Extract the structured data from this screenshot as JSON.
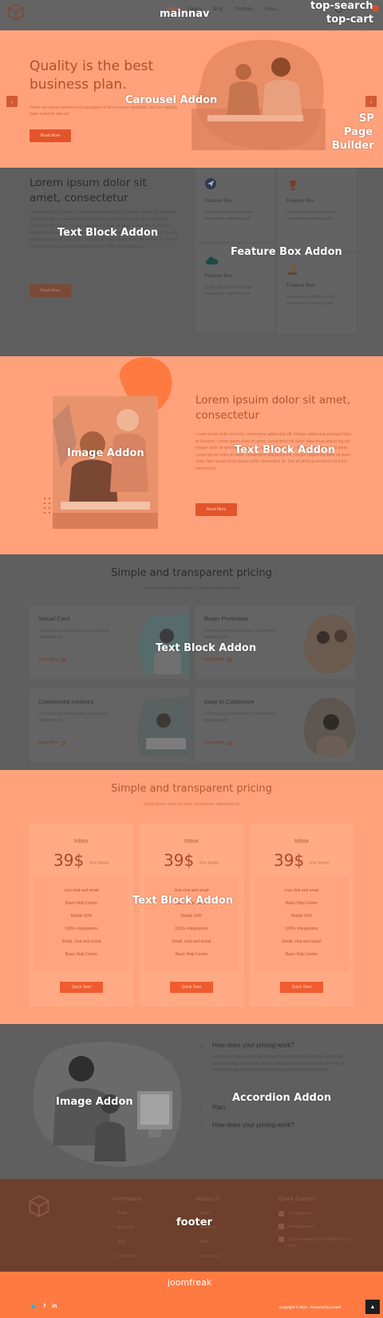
{
  "overlay_labels": {
    "mainnav": "mainnav",
    "top_search": "top-search",
    "top_cart": "top-cart",
    "carousel": "Carousel Addon",
    "sp_page_builder": [
      "SP",
      "Page",
      "Builder"
    ],
    "text_block_1": "Text Block Addon",
    "feature_box": "Feature Box Addon",
    "image_1": "Image Addon",
    "text_block_2": "Text Block Addon",
    "text_block_3": "Text Block Addon",
    "text_block_4": "Text Block Addon",
    "image_2": "Image Addon",
    "accordion": "Accordion Addon",
    "footer": "footer"
  },
  "header": {
    "nav": [
      {
        "label": "Home",
        "active": true
      },
      {
        "label": "Pages",
        "has_dropdown": true
      },
      {
        "label": "Blog",
        "has_dropdown": true
      },
      {
        "label": "Portfolio",
        "has_dropdown": true
      },
      {
        "label": "Shop",
        "has_dropdown": true
      }
    ]
  },
  "carousel": {
    "title": "Quality is the best business plan.",
    "description": "There are many variations of passages of lorem ipsum available, but the majority have suffered altered.",
    "button": "Read More",
    "prev": "‹",
    "next": "›"
  },
  "intro": {
    "title": "Lorem ipsum dolor sit amet, consectetur",
    "body": "Lorem ipsum dolor sit amet, consectetur adipiscing elit. Integer adipiscing and eget dolor at tincidunt. Lorem ipsum dolor sit amet, consectetur elit dolor. Maecenas adipiscing elit. Integer dolor sit amet ipsum dolor sit amet. Donec ipsum ultricies ullamcorper sit amet. Lorem ipsum dolor sit amet, consectetur adipiscing elit. Integer adipiscing dolor sit amet dolor. Nam ipsum lorem ipsum dolor elementum sit. Sed sit amet quam lorem sit dolor elementum. Nec dolor sit amet ipsum.",
    "button": "Read More"
  },
  "feature_boxes": [
    {
      "title": "Feature Box",
      "text": "Lorem ipsum dolor sit amet, consectetur adipiscing elit",
      "icon": "send-icon"
    },
    {
      "title": "Feature Box",
      "text": "Lorem ipsum dolor sit amet, consectetur adipiscing elit",
      "icon": "trophy-icon"
    },
    {
      "title": "Feature Box",
      "text": "Lorem ipsum dolor sit amet, consectetur adipiscing elit",
      "icon": "cloud-icon"
    },
    {
      "title": "Feature Box",
      "text": "Lorem ipsum dolor sit amet, consectetur adipiscing elit",
      "icon": "hand-coin-icon"
    }
  ],
  "about": {
    "title": "Lorem ipsuim dolor sit amet, consectetur",
    "body": "Lorem ipsum dolor sit amet, consectetur adipiscing elit. Integer adipiscing and eget dolor at tincidunt. Lorem ipsum dolor sit amet, consectetur elit dolor. Maecenas adipiscing elit. Integer dolor sit amet ipsum dolor sit amet. Donec ipsum ultricies ullamcorper sit amet. Lorem ipsum dolor sit amet, consectetur adipiscing elit. Integer adipiscing dolor sit amet dolor. Nam ipsum lorem ipsum dolor elementum sit. Sed sit amet quam lorem sit dolor elementum.",
    "button": "Read More"
  },
  "pricing_features": {
    "heading": "Simple and transparent pricing",
    "sub": "Lorem ipsum dolor sit amet, consectetur adipiscing elit",
    "cards": [
      {
        "title": "Virtual Card",
        "text": "Lorem ipsum dolor sit amet, consectetur adipiscing elit",
        "link": "Read More"
      },
      {
        "title": "Buyer Protection",
        "text": "Lorem ipsum dolor sit amet, consectetur adipiscing elit",
        "link": "Read More"
      },
      {
        "title": "Customized Invoices",
        "text": "Lorem ipsum dolor sit amet, consectetur adipiscing elit",
        "link": "Read More"
      },
      {
        "title": "Easy to Customize",
        "text": "Lorem ipsum dolor sit amet, consectetur adipiscing elit",
        "link": "Read More"
      }
    ]
  },
  "pricing_tables": {
    "heading": "Simple and transparent pricing",
    "sub": "Lorem ipsum dolor sit amet, consectetur adipiscing elit",
    "tables": [
      {
        "name": "Inbox",
        "price": "39$",
        "period": "/Per Month",
        "button": "Quick Start"
      },
      {
        "name": "Inbox",
        "price": "39$",
        "period": "/Per Month",
        "button": "Quick Start"
      },
      {
        "name": "Inbox",
        "price": "39$",
        "period": "/Per Month",
        "button": "Quick Start"
      }
    ],
    "features": [
      "Live chat and email",
      "Basic Help Center",
      "Mobile SDK",
      "1000+ integrations",
      "Email, chat and social",
      "Basic Help Center"
    ]
  },
  "accordion": {
    "items": [
      {
        "q": "How does your pricing work?",
        "open": true
      },
      {
        "q": "Plan",
        "open": false
      },
      {
        "q": "How does your pricing work?",
        "open": false
      }
    ],
    "answer": "Lorem ipsum dolor sit amet, consectetur adipiscing elit. Integer adipiscing and eget dolor at tincidunt. Integer adipiscing dolor sit amet ipsum dolor sit amet. Nam ipsum lorem ipsum dolor elementum sit dolor sit amet."
  },
  "footer": {
    "info_title": "Information",
    "info_links": [
      "Home",
      "About Us",
      "Blog",
      "Contact Us"
    ],
    "about_title": "About Us",
    "about_links": [
      "Home",
      "About Us",
      "Blog",
      "Contact Us"
    ],
    "contact_title": "Quick Contact",
    "phone": "+012345678",
    "email": "info@site.com",
    "address": "Demo address 1234, ABDE City 12 Ave"
  },
  "bottom": {
    "brand": "joomfreak",
    "copyright": "Copyright © 2021 , Powered by Kreatif",
    "social": [
      "twitter-icon",
      "facebook-icon",
      "linkedin-icon"
    ],
    "back_to_top": "▲"
  },
  "colors": {
    "accent": "#ff7a41",
    "peach": "#ffa27b",
    "gray": "#5f5f5f",
    "footer_brown": "#6e3f2d"
  }
}
